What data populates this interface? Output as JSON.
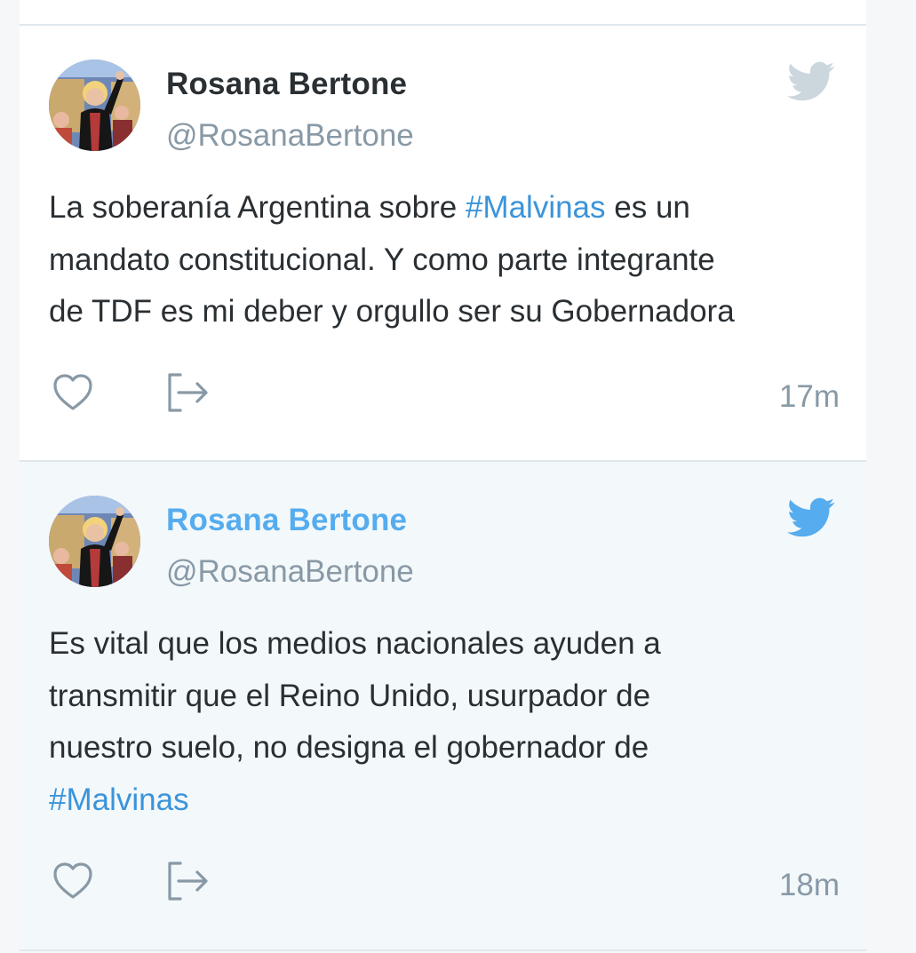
{
  "tweets": [
    {
      "author_name": "Rosana Bertone",
      "author_handle": "@RosanaBertone",
      "text_lines": [
        [
          {
            "text": "La soberanía Argentina sobre "
          },
          {
            "text": "#Malvinas",
            "hashtag": true
          },
          {
            "text": " es un"
          }
        ],
        [
          {
            "text": "mandato constitucional. Y como parte integrante"
          }
        ],
        [
          {
            "text": "de TDF es mi deber y orgullo ser su Gobernadora"
          }
        ]
      ],
      "timestamp": "17m",
      "bird_color": "#ccd6dd",
      "name_color": "#292f33"
    },
    {
      "author_name": "Rosana Bertone",
      "author_handle": "@RosanaBertone",
      "text_lines": [
        [
          {
            "text": "Es vital que los medios nacionales ayuden a"
          }
        ],
        [
          {
            "text": "transmitir que el Reino Unido, usurpador de"
          }
        ],
        [
          {
            "text": "nuestro suelo, no designa el gobernador de"
          }
        ],
        [
          {
            "text": "#Malvinas",
            "hashtag": true
          }
        ]
      ],
      "timestamp": "18m",
      "bird_color": "#55acee",
      "name_color": "#55acee"
    }
  ],
  "icons": {
    "like": "heart-icon",
    "share": "share-icon",
    "brand": "twitter-bird-icon"
  },
  "colors": {
    "hashtag": "#3b94d9",
    "muted": "#8899a6",
    "text": "#292f33",
    "highlight_background": "#f3f8fb"
  }
}
